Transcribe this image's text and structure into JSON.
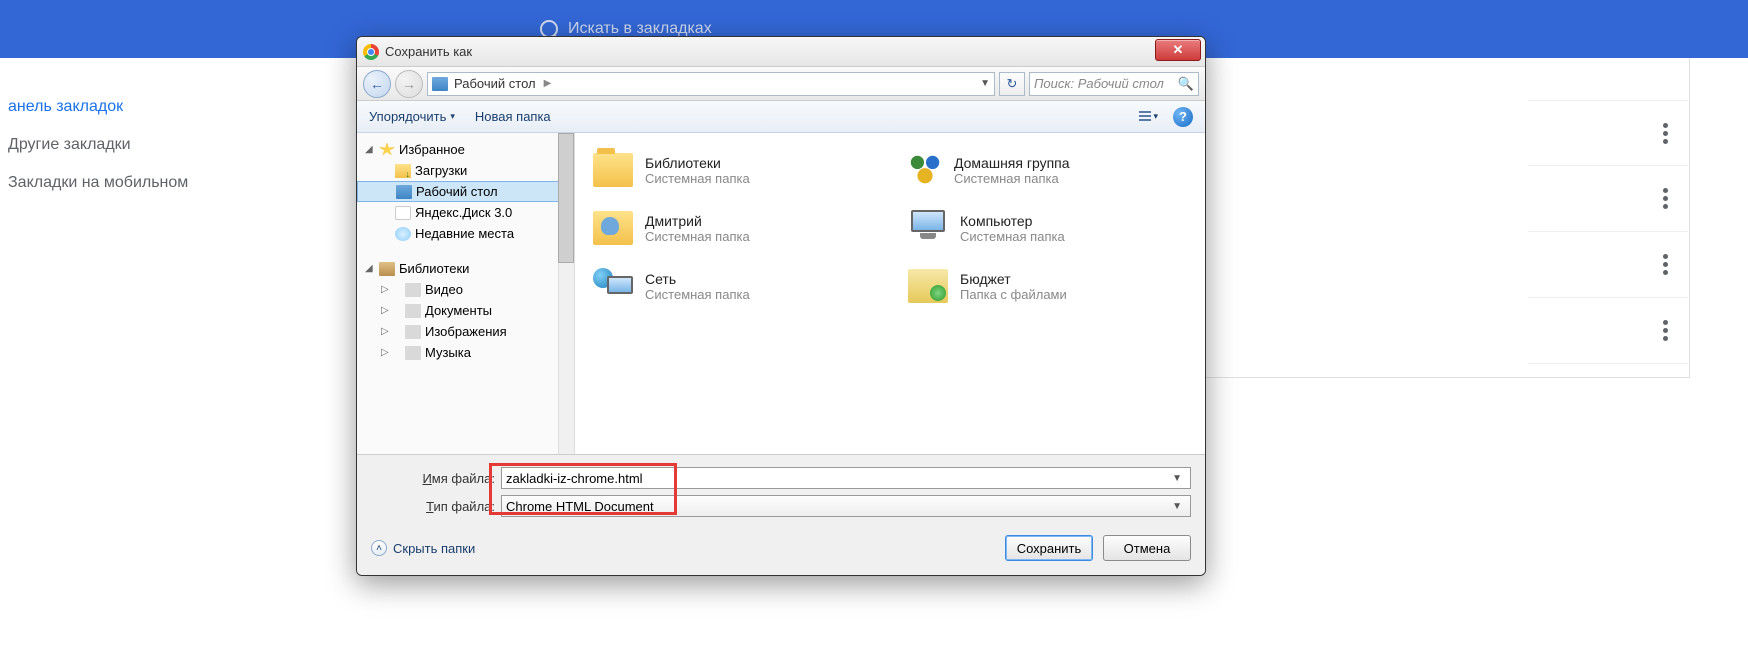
{
  "bg": {
    "search_placeholder": "Искать в закладках",
    "sidebar": [
      "анель закладок",
      "Другие закладки",
      "Закладки на мобильном"
    ]
  },
  "dialog": {
    "title": "Сохранить как",
    "address": "Рабочий стол",
    "search_placeholder": "Поиск: Рабочий стол",
    "toolbar": {
      "organize": "Упорядочить",
      "new_folder": "Новая папка"
    },
    "tree": {
      "favorites": "Избранное",
      "downloads": "Загрузки",
      "desktop": "Рабочий стол",
      "ydisk": "Яндекс.Диск 3.0",
      "recent": "Недавние места",
      "libraries": "Библиотеки",
      "video": "Видео",
      "documents": "Документы",
      "images": "Изображения",
      "music": "Музыка"
    },
    "files": {
      "libraries": {
        "name": "Библиотеки",
        "sub": "Системная папка"
      },
      "homegroup": {
        "name": "Домашняя группа",
        "sub": "Системная папка"
      },
      "user": {
        "name": "Дмитрий",
        "sub": "Системная папка"
      },
      "computer": {
        "name": "Компьютер",
        "sub": "Системная папка"
      },
      "network": {
        "name": "Сеть",
        "sub": "Системная папка"
      },
      "budget": {
        "name": "Бюджет",
        "sub": "Папка с файлами"
      }
    },
    "filename_label_pre": "И",
    "filename_label_post": "мя файла:",
    "filetype_label_pre": "Т",
    "filetype_label_post": "ип файла:",
    "filename_value": "zakladki-iz-chrome.html",
    "filetype_value": "Chrome HTML Document",
    "hide_folders": "Скрыть папки",
    "save": "Сохранить",
    "cancel": "Отмена"
  }
}
